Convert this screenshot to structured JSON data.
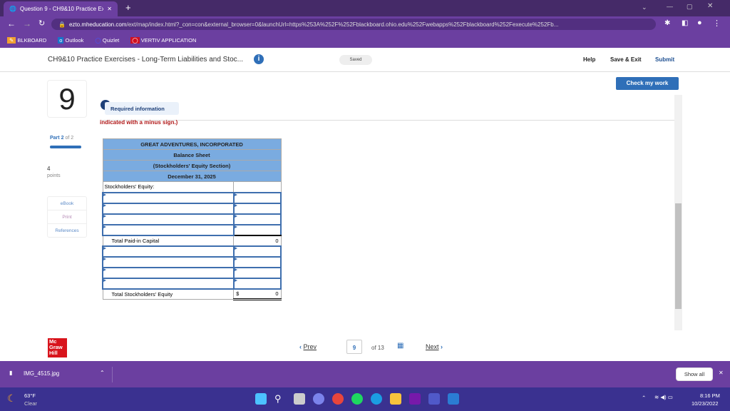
{
  "browser": {
    "tab_title": "Question 9 - CH9&10 Practice Ex",
    "url_domain": "ezto.mheducation.com",
    "url_rest": "/ext/map/index.html?_con=con&external_browser=0&launchUrl=https%253A%252F%252Fblackboard.ohio.edu%252Fwebapps%252Fblackboard%252Fexecute%252Fb...",
    "bookmarks": [
      "BLKBOARD",
      "Outlook",
      "Quizlet",
      "VERTIV APPLICATION"
    ]
  },
  "header": {
    "title": "CH9&10 Practice Exercises - Long-Term Liabilities and Stoc...",
    "saved": "Saved",
    "help": "Help",
    "save_exit": "Save & Exit",
    "submit": "Submit"
  },
  "check_label": "Check my work",
  "question": {
    "number": "9",
    "required": "Required information",
    "instruction": "indicated with a minus sign.)",
    "part_label": "Part",
    "part": "2",
    "part_of": "of 2",
    "progress": 1.0,
    "points": "4",
    "points_label": "points"
  },
  "side_links": [
    "eBook",
    "Print",
    "References"
  ],
  "statement": {
    "company": "GREAT ADVENTURES, INCORPORATED",
    "title": "Balance Sheet",
    "subtitle": "(Stockholders' Equity Section)",
    "date": "December 31, 2025",
    "section": "Stockholders' Equity:",
    "total_paid": "Total Paid-in Capital",
    "total_paid_value": "0",
    "total_equity": "Total Stockholders' Equity",
    "currency": "$",
    "total_equity_value": "0"
  },
  "nav": {
    "prev": "Prev",
    "current": "9",
    "of": "of 13",
    "next": "Next"
  },
  "logo": "Mc Graw Hill",
  "download": {
    "file": "IMG_4515.jpg",
    "show_all": "Show all"
  },
  "taskbar": {
    "temp": "63°F",
    "weather": "Clear",
    "time": "8:16 PM",
    "date": "10/23/2022"
  }
}
